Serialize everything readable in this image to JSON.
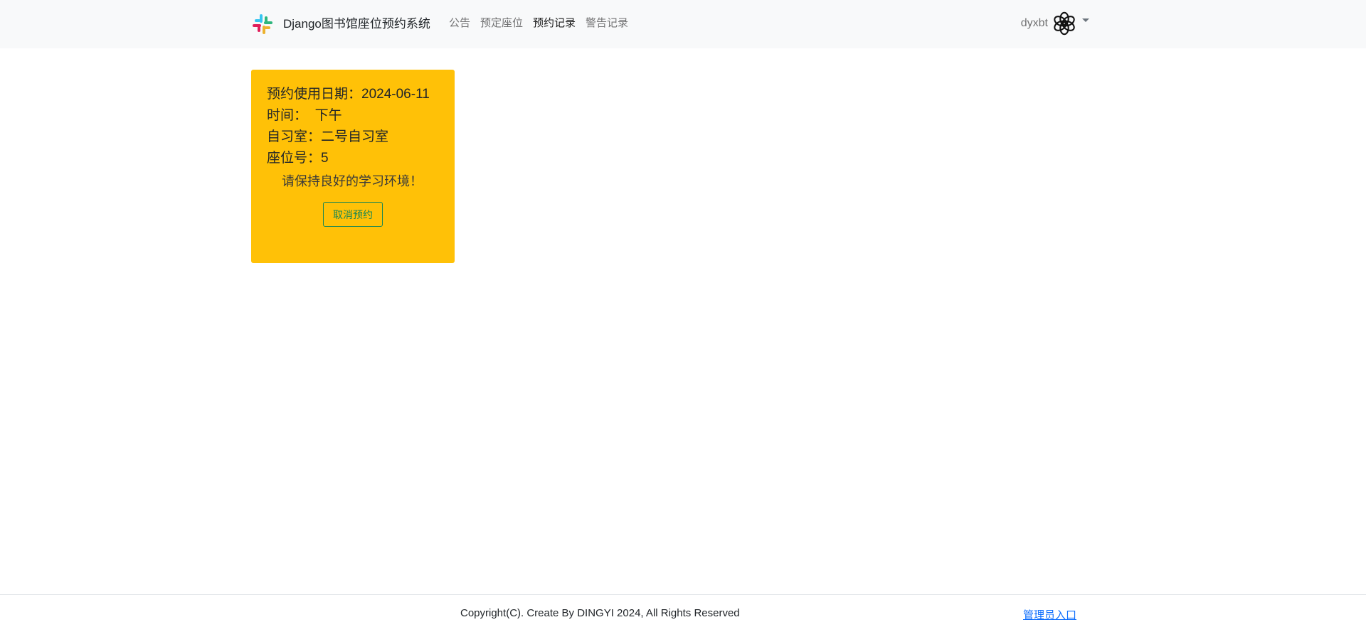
{
  "navbar": {
    "brand_logo_icon": "slack-logo-icon",
    "brand": "Django图书馆座位预约系统",
    "links": [
      {
        "label": "公告",
        "active": false
      },
      {
        "label": "预定座位",
        "active": false
      },
      {
        "label": "预约记录",
        "active": true
      },
      {
        "label": "警告记录",
        "active": false
      }
    ],
    "user": {
      "name": "dyxbt",
      "avatar_icon": "openai-logo-avatar-icon",
      "dropdown_icon": "caret-down-icon"
    }
  },
  "reservation": {
    "date_label": "预约使用日期：",
    "date": "2024-06-11",
    "time_label": "时间：",
    "time": "下午",
    "room_label": "自习室：",
    "room": "二号自习室",
    "seat_label": "座位号：",
    "seat": "5",
    "note": "请保持良好的学习环境！",
    "cancel_label": "取消预约",
    "card_color": "#ffc107",
    "button_color": "#198754"
  },
  "footer": {
    "copyright": "Copyright(C). Create By DINGYI 2024, All Rights Reserved",
    "admin_link": "管理员入口"
  }
}
